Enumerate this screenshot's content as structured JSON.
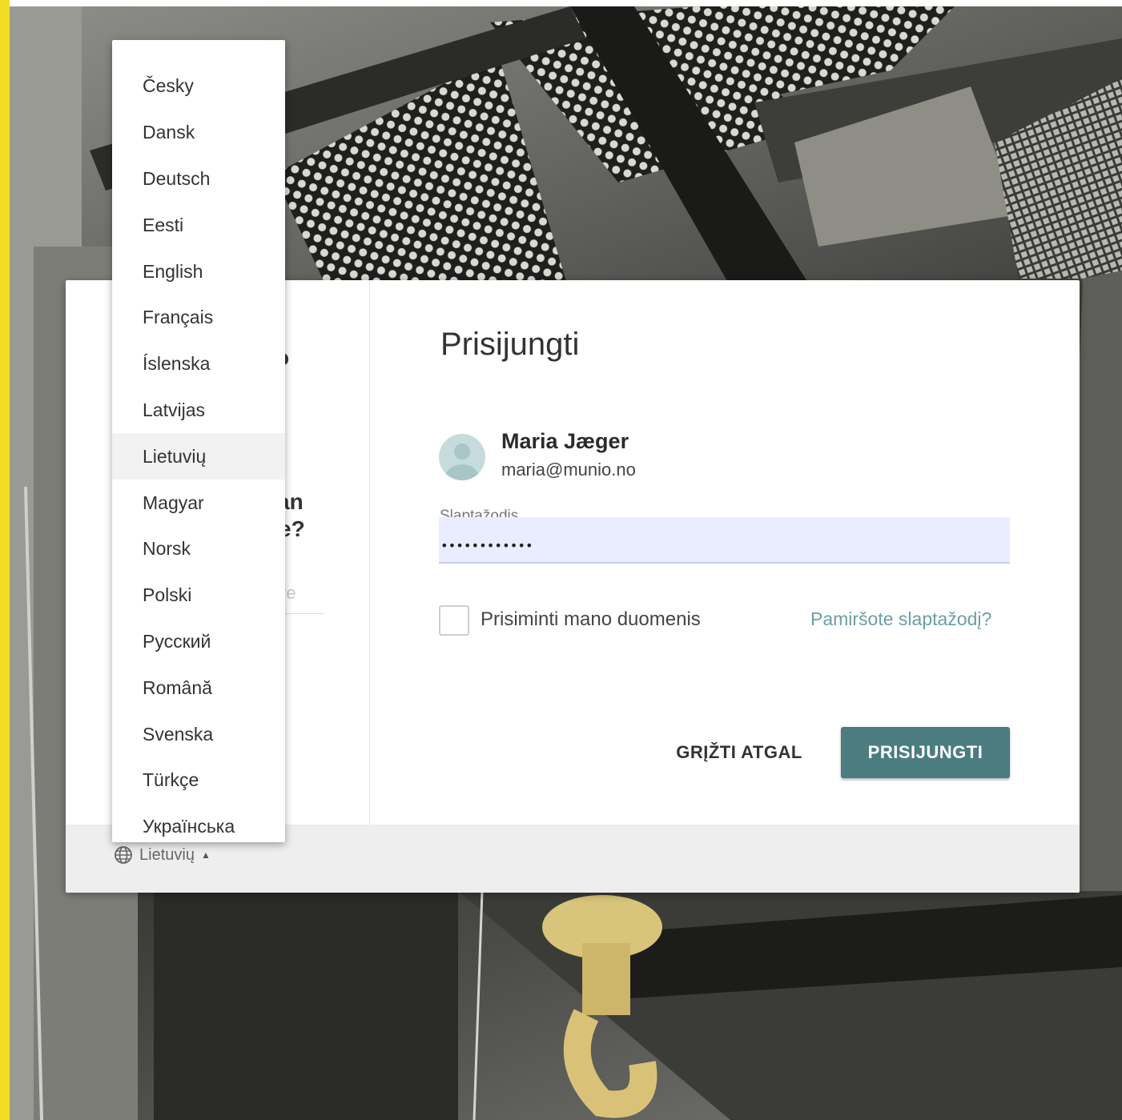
{
  "login": {
    "title": "Prisijungti",
    "user_name": "Maria Jæger",
    "user_email": "maria@munio.no",
    "password_label": "Slaptažodis",
    "password_value": "••••••••••••",
    "remember_label": "Prisiminti mano duomenis",
    "forgot_link": "Pamiršote slaptažodį?",
    "back_button": "GRĮŽTI ATGAL",
    "login_button": "PRISIJUNGTI",
    "accent_color": "#4b7c80"
  },
  "left_panel_peek": {
    "fragment_top": "o",
    "fragment_line1": "an",
    "fragment_line2": "e?",
    "fragment_faded": "re"
  },
  "language": {
    "current": "Lietuvių",
    "options": [
      "Česky",
      "Dansk",
      "Deutsch",
      "Eesti",
      "English",
      "Français",
      "Íslenska",
      "Latvijas",
      "Lietuvių",
      "Magyar",
      "Norsk",
      "Polski",
      "Русский",
      "Română",
      "Svenska",
      "Türkçe",
      "Українська"
    ],
    "selected_index": 8
  },
  "colors": {
    "frame_strip": "#f4dc25",
    "password_field_bg": "#e9edff",
    "link": "#6a9fa5"
  }
}
